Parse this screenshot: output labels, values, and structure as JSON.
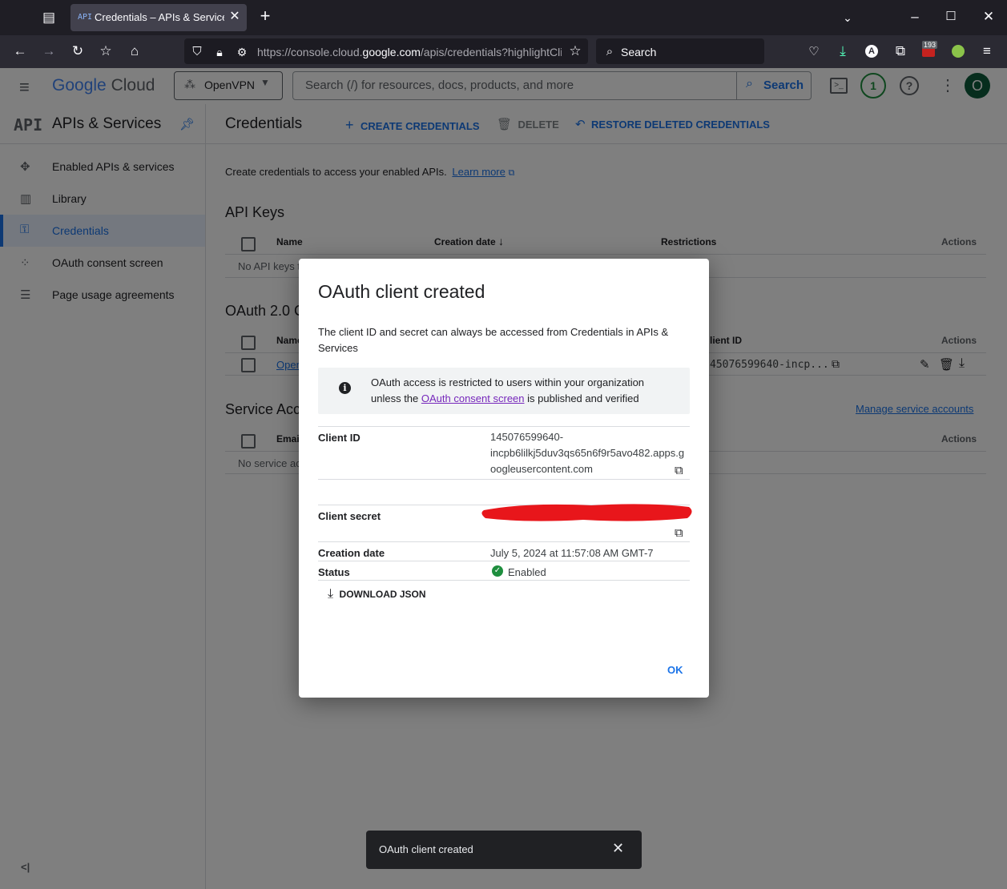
{
  "browser": {
    "tab_title": "Credentials – APIs & Services – ",
    "tab_favicon": "API",
    "url_prefix": "https://console.cloud.",
    "url_domain": "google.com",
    "url_suffix": "/apis/credentials?highlightCli",
    "search_placeholder": "Search",
    "extension_badge": "193",
    "account_letter": "A"
  },
  "header": {
    "logo_google": "Google",
    "logo_cloud": "Cloud",
    "project": "OpenVPN",
    "search_placeholder": "Search (/) for resources, docs, products, and more",
    "search_button": "Search",
    "notifications_count": "1",
    "avatar_letter": "O"
  },
  "sidebar": {
    "product_icon": "API",
    "title": "APIs & Services",
    "items": [
      {
        "label": "Enabled APIs & services",
        "icon": "diamond-icon"
      },
      {
        "label": "Library",
        "icon": "library-icon"
      },
      {
        "label": "Credentials",
        "icon": "key-icon"
      },
      {
        "label": "OAuth consent screen",
        "icon": "dots-icon"
      },
      {
        "label": "Page usage agreements",
        "icon": "settings-list-icon"
      }
    ],
    "collapse_glyph": "<|"
  },
  "page": {
    "title": "Credentials",
    "create_label": "CREATE CREDENTIALS",
    "delete_label": "DELETE",
    "restore_label": "RESTORE DELETED CREDENTIALS",
    "intro": "Create credentials to access your enabled APIs.",
    "learn_more": "Learn more",
    "api_keys": {
      "heading": "API Keys",
      "col_name": "Name",
      "col_date": "Creation date",
      "col_restrictions": "Restrictions",
      "col_actions": "Actions",
      "empty": "No API keys t"
    },
    "oauth": {
      "heading": "OAuth 2.0 C",
      "col_name": "Name",
      "col_client_id": "lient ID",
      "col_actions": "Actions",
      "row_name": "Open",
      "row_client_id": "45076599640-incp..."
    },
    "service": {
      "heading": "Service Acc",
      "manage_link": "Manage service accounts",
      "col_email": "Emai",
      "col_actions": "Actions",
      "empty": "No service ac"
    }
  },
  "dialog": {
    "title": "OAuth client created",
    "description": "The client ID and secret can always be accessed from Credentials in APIs & Services",
    "notice_before": "OAuth access is restricted to users within your organization unless the ",
    "notice_link": "OAuth consent screen",
    "notice_after": " is published and verified",
    "client_id_label": "Client ID",
    "client_id_value": [
      "145076599640-",
      "incpb6lilkj5duv3qs65n6f9r5avo482.apps.g",
      "oogleusercontent.com"
    ],
    "client_secret_label": "Client secret",
    "creation_date_label": "Creation date",
    "creation_date_value": "July 5, 2024 at 11:57:08 AM GMT-7",
    "status_label": "Status",
    "status_value": "Enabled",
    "download_label": "DOWNLOAD JSON",
    "ok_label": "OK",
    "redaction_color": "#e8161b"
  },
  "toast": {
    "message": "OAuth client created"
  }
}
